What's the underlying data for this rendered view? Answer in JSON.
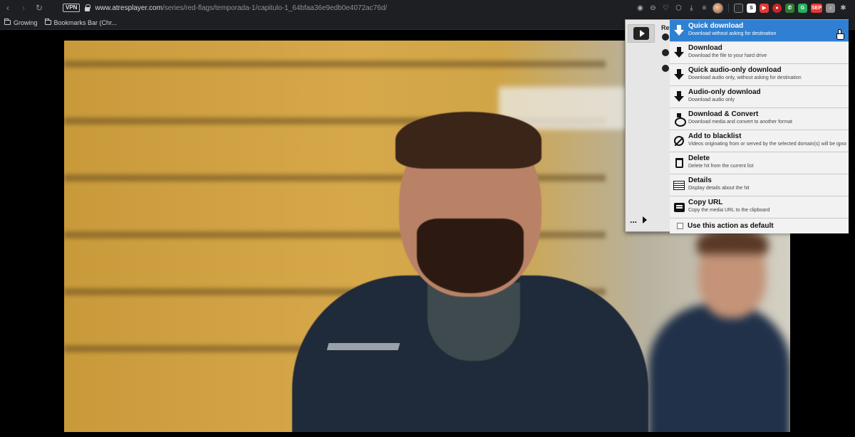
{
  "browser": {
    "url_host": "www.atresplayer.com",
    "url_path": "/series/red-flags/temporada-1/capitulo-1_64bfaa36e9edb0e4072ac76d/",
    "vpn_label": "VPN",
    "extensions": [
      {
        "name": "camera-icon",
        "color": "#1e1f22"
      },
      {
        "name": "badge-ext",
        "color": "#e53935",
        "label": "SEP"
      }
    ]
  },
  "bookmarks": [
    {
      "label": "Growing"
    },
    {
      "label": "Bookmarks Bar (Chr..."
    }
  ],
  "popup": {
    "hit_title": "Re",
    "menu": [
      {
        "label": "Quick download",
        "desc": "Download without asking for destination",
        "icon": "quick-download-icon",
        "active": true
      },
      {
        "label": "Download",
        "desc": "Download the file to your hard drive",
        "icon": "download-icon",
        "active": false
      },
      {
        "label": "Quick audio-only download",
        "desc": "Download audio only, without asking for destination",
        "icon": "quick-audio-download-icon",
        "active": false
      },
      {
        "label": "Audio-only download",
        "desc": "Download audio only",
        "icon": "audio-download-icon",
        "active": false
      },
      {
        "label": "Download & Convert",
        "desc": "Download media and convert to another format",
        "icon": "convert-icon",
        "active": false
      },
      {
        "label": "Add to blacklist",
        "desc": "Videos originating from or served by the selected domain(s) will be ignor...",
        "icon": "blacklist-icon",
        "active": false
      },
      {
        "label": "Delete",
        "desc": "Delete hit from the current list",
        "icon": "trash-icon",
        "active": false
      },
      {
        "label": "Details",
        "desc": "Display details about the hit",
        "icon": "details-icon",
        "active": false
      },
      {
        "label": "Copy URL",
        "desc": "Copy the media URL to the clipboard",
        "icon": "copy-url-icon",
        "active": false
      }
    ],
    "default_label": "Use this action as default",
    "more_label": "..."
  },
  "colors": {
    "active_item": "#2f80d3",
    "toolbar_bg": "#1e1f22"
  }
}
